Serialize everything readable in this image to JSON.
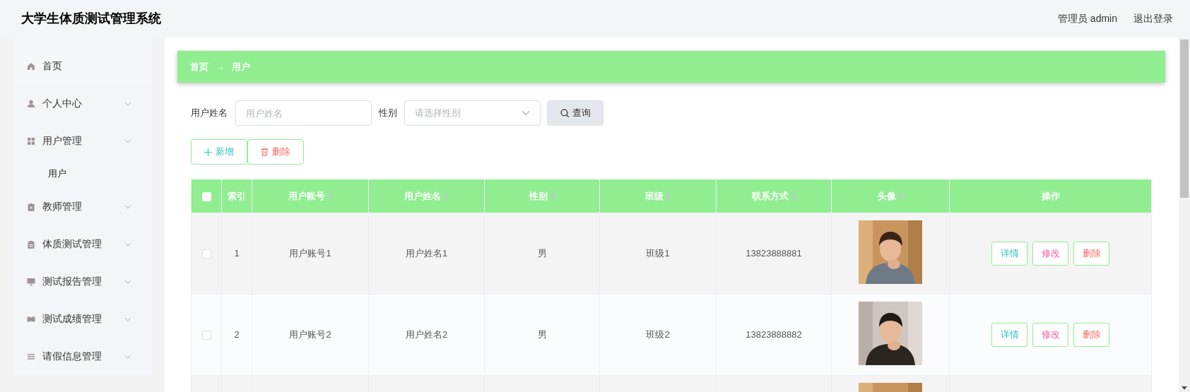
{
  "header": {
    "title": "大学生体质测试管理系统",
    "user": "管理员 admin",
    "logout": "退出登录"
  },
  "sidebar": {
    "items": [
      {
        "label": "首页",
        "selected": true
      },
      {
        "label": "个人中心",
        "kind": "submenu",
        "selected": false
      },
      {
        "label": "用户管理",
        "kind": "submenu",
        "selected": false,
        "children": [
          {
            "label": "用户",
            "selected": false
          }
        ]
      },
      {
        "label": "教师管理",
        "kind": "submenu",
        "selected": false
      },
      {
        "label": "体质测试管理",
        "kind": "submenu",
        "selected": false
      },
      {
        "label": "测试报告管理",
        "kind": "submenu",
        "selected": false
      },
      {
        "label": "测试成绩管理",
        "kind": "submenu",
        "selected": false
      },
      {
        "label": "请假信息管理",
        "kind": "submenu",
        "selected": false
      }
    ]
  },
  "breadcrumb": [
    "首页",
    "→",
    "用户"
  ],
  "search": {
    "name_label": "用户姓名",
    "name_placeholder": "用户姓名",
    "gender_label": "性别",
    "gender_placeholder": "请选择性别",
    "button": "查询"
  },
  "actions": {
    "add": "新增",
    "delete": "删除"
  },
  "table": {
    "select_all_checked": false,
    "columns": [
      {
        "label": "索引",
        "sortable": false
      },
      {
        "label": "用户账号",
        "sortable": true
      },
      {
        "label": "用户姓名",
        "sortable": true
      },
      {
        "label": "性别",
        "sortable": true
      },
      {
        "label": "班级",
        "sortable": true
      },
      {
        "label": "联系方式",
        "sortable": true
      },
      {
        "label": "头像",
        "sortable": true
      },
      {
        "label": "操作",
        "sortable": false
      }
    ],
    "rows": [
      {
        "checked": false,
        "index": "1",
        "account": "用户账号1",
        "name": "用户姓名1",
        "gender": "男",
        "class": "班级1",
        "phone": "13823888881",
        "avatar": {
          "kind": "picture"
        },
        "buttons": [
          "详情",
          "修改",
          "删除"
        ]
      },
      {
        "checked": false,
        "index": "2",
        "account": "用户账号2",
        "name": "用户姓名2",
        "gender": "男",
        "class": "班级2",
        "phone": "13823888882",
        "avatar": {
          "kind": "picture"
        },
        "buttons": [
          "详情",
          "修改",
          "删除"
        ]
      },
      {
        "avatar": {
          "kind": "picture"
        }
      }
    ]
  }
}
